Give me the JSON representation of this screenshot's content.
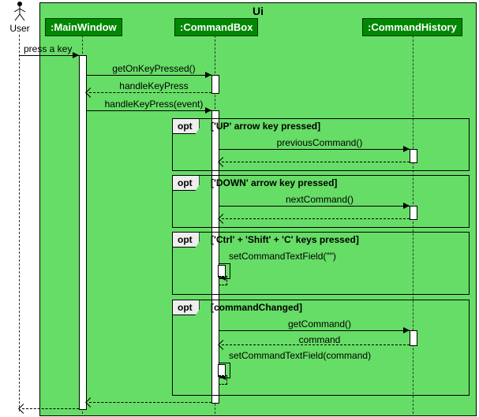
{
  "frame": {
    "title": "Ui"
  },
  "actor": {
    "label": "User"
  },
  "participants": {
    "p1": ":MainWindow",
    "p2": ":CommandBox",
    "p3": ":CommandHistory"
  },
  "messages": {
    "m1": "press a key",
    "m2": "getOnKeyPressed()",
    "m3": "handleKeyPress",
    "m4": "handleKeyPress(event)",
    "m5": "previousCommand()",
    "m6": "nextCommand()",
    "m7": "setCommandTextField(\"\")",
    "m8": "getCommand()",
    "m9": "command",
    "m10": "setCommandTextField(command)"
  },
  "fragments": {
    "opt": "opt",
    "g1": "['UP' arrow key pressed]",
    "g2": "['DOWN' arrow key pressed]",
    "g3": "['Ctrl' + 'Shift' + 'C' keys pressed]",
    "g4": "[commandChanged]"
  },
  "chart_data": {
    "type": "uml-sequence-diagram",
    "frame": "Ui",
    "actor": "User",
    "participants": [
      ":MainWindow",
      ":CommandBox",
      ":CommandHistory"
    ],
    "interactions": [
      {
        "from": "User",
        "to": ":MainWindow",
        "label": "press a key",
        "kind": "sync"
      },
      {
        "from": ":MainWindow",
        "to": ":CommandBox",
        "label": "getOnKeyPressed()",
        "kind": "sync"
      },
      {
        "from": ":CommandBox",
        "to": ":MainWindow",
        "label": "handleKeyPress",
        "kind": "return"
      },
      {
        "from": ":MainWindow",
        "to": ":CommandBox",
        "label": "handleKeyPress(event)",
        "kind": "sync"
      },
      {
        "fragment": "opt",
        "guard": "['UP' arrow key pressed]",
        "inside": [
          {
            "from": ":CommandBox",
            "to": ":CommandHistory",
            "label": "previousCommand()",
            "kind": "sync"
          },
          {
            "from": ":CommandHistory",
            "to": ":CommandBox",
            "label": "",
            "kind": "return"
          }
        ]
      },
      {
        "fragment": "opt",
        "guard": "['DOWN' arrow key pressed]",
        "inside": [
          {
            "from": ":CommandBox",
            "to": ":CommandHistory",
            "label": "nextCommand()",
            "kind": "sync"
          },
          {
            "from": ":CommandHistory",
            "to": ":CommandBox",
            "label": "",
            "kind": "return"
          }
        ]
      },
      {
        "fragment": "opt",
        "guard": "['Ctrl' + 'Shift' + 'C' keys pressed]",
        "inside": [
          {
            "from": ":CommandBox",
            "to": ":CommandBox",
            "label": "setCommandTextField(\"\")",
            "kind": "self"
          }
        ]
      },
      {
        "fragment": "opt",
        "guard": "[commandChanged]",
        "inside": [
          {
            "from": ":CommandBox",
            "to": ":CommandHistory",
            "label": "getCommand()",
            "kind": "sync"
          },
          {
            "from": ":CommandHistory",
            "to": ":CommandBox",
            "label": "command",
            "kind": "return"
          },
          {
            "from": ":CommandBox",
            "to": ":CommandBox",
            "label": "setCommandTextField(command)",
            "kind": "self"
          }
        ]
      },
      {
        "from": ":CommandBox",
        "to": ":MainWindow",
        "label": "",
        "kind": "return"
      },
      {
        "from": ":MainWindow",
        "to": "User",
        "label": "",
        "kind": "return"
      }
    ]
  }
}
